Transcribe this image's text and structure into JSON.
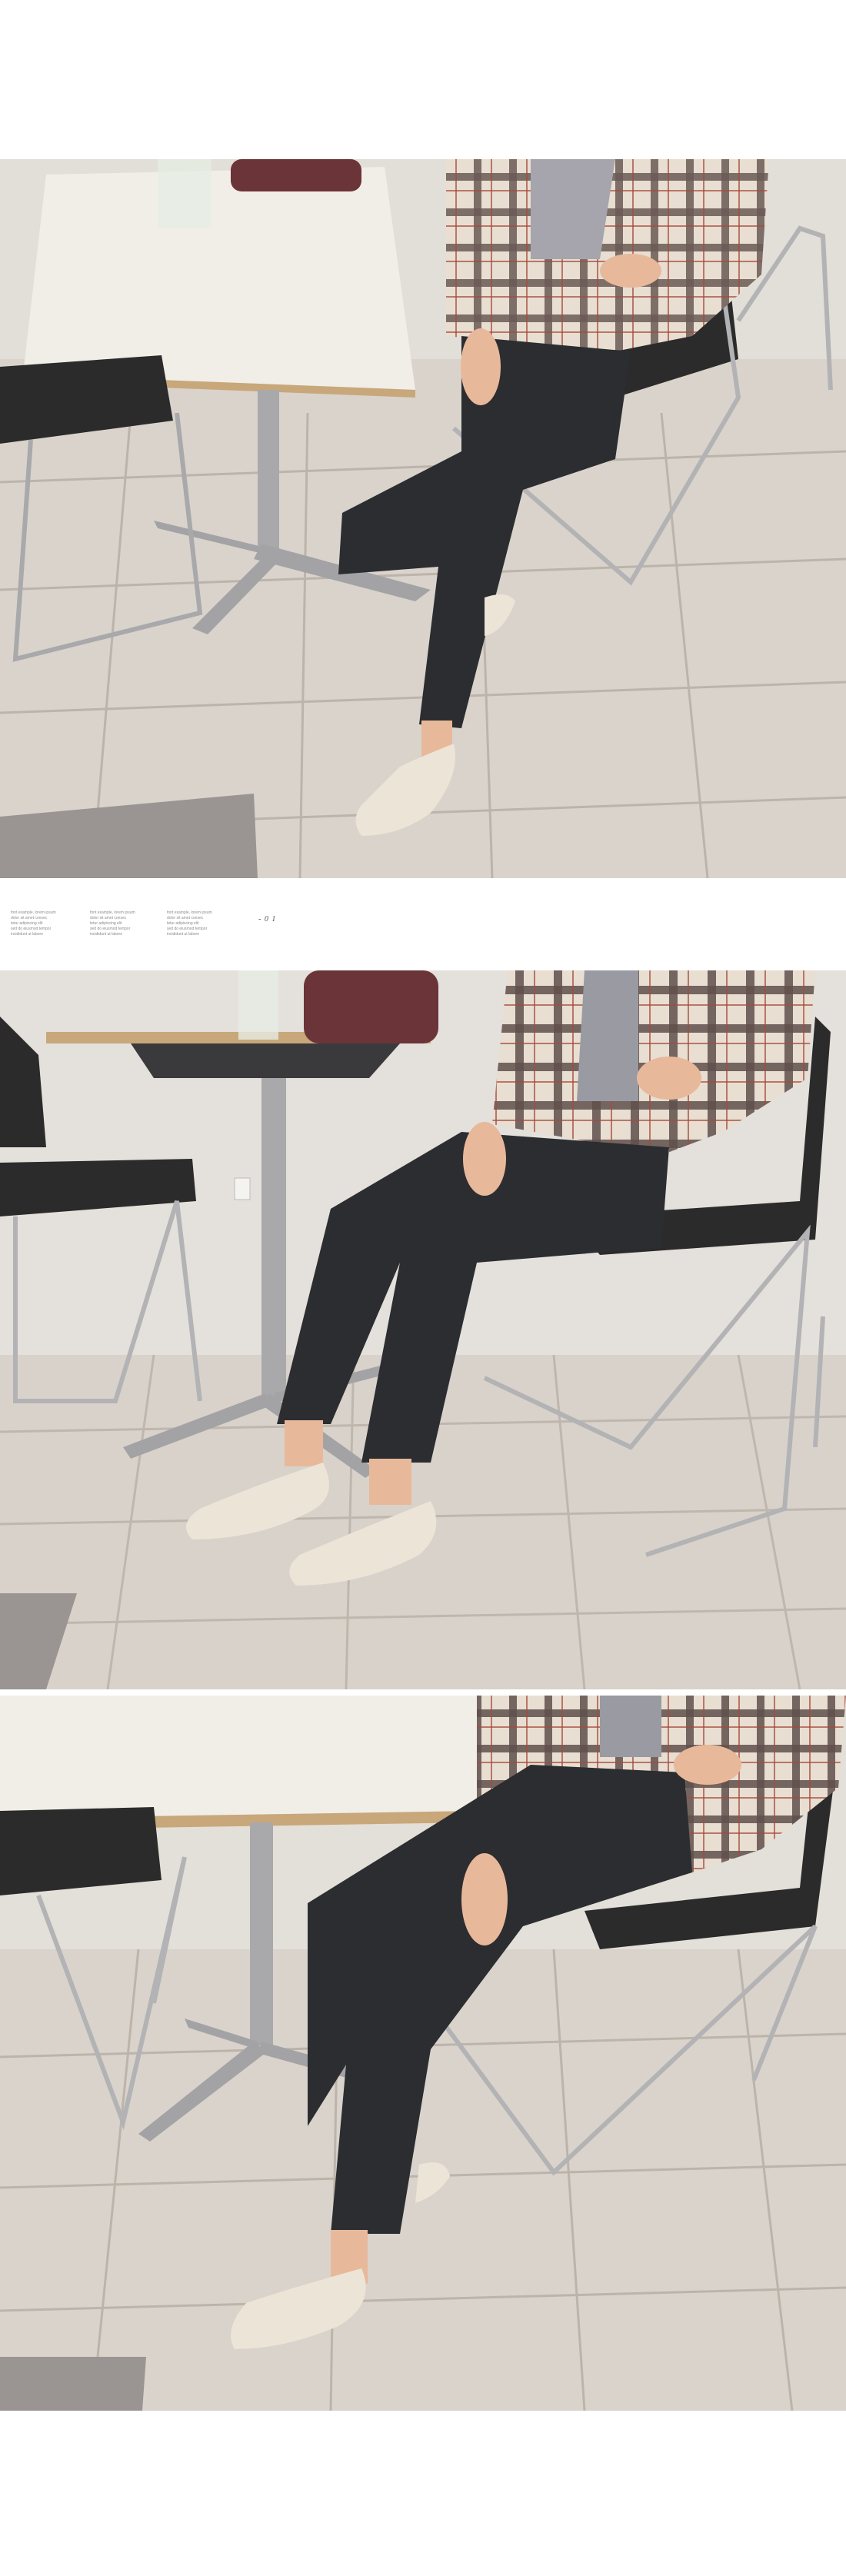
{
  "photos": [
    {
      "id": "photo-1",
      "alt": ""
    },
    {
      "id": "photo-2",
      "alt": ""
    },
    {
      "id": "photo-3",
      "alt": ""
    }
  ],
  "caption": {
    "page_number": "- 0 1",
    "notes": [
      [
        "font example, lorem ipsum",
        "dolor sit amet consec",
        "tetur adipiscing elit",
        "sed do eiusmod tempor",
        "incididunt ut labore"
      ],
      [
        "font example, lorem ipsum",
        "dolor sit amet consec",
        "tetur adipiscing elit",
        "sed do eiusmod tempor",
        "incididunt ut labore"
      ],
      [
        "font example, lorem ipsum",
        "dolor sit amet consec",
        "tetur adipiscing elit",
        "sed do eiusmod tempor",
        "incididunt ut labore"
      ]
    ]
  },
  "colors": {
    "background": "#ffffff",
    "floor": "#d9d3cc",
    "floor_grout": "#bdb5ac",
    "wall": "#e4e0db",
    "table_top": "#f2efe9",
    "table_edge": "#c8a77a",
    "metal": "#a9a9ab",
    "chair_seat": "#2b2b2b",
    "jeans": "#2c2d30",
    "skin": "#e7b99a",
    "jacket_base": "#e8ded1",
    "jacket_check": "#5a4a46",
    "jacket_trim": "#f6f2ea",
    "sweater": "#9a9aa2",
    "shoe": "#e9e1d3",
    "bag": "#6b3438",
    "rug": "#9a9592"
  }
}
